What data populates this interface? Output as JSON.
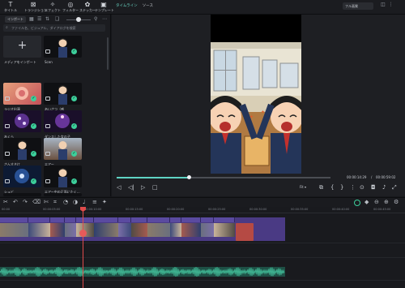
{
  "toolbar": {
    "tools": [
      {
        "icon": "text-T-icon",
        "label": "タイトル"
      },
      {
        "icon": "transition-icon",
        "label": "トランジション"
      },
      {
        "icon": "effects-icon",
        "label": "エフェクト"
      },
      {
        "icon": "filter-icon",
        "label": "フィルター"
      },
      {
        "icon": "sticker-icon",
        "label": "ステッカー"
      },
      {
        "icon": "template-icon",
        "label": "テンプレート"
      }
    ],
    "tabs": [
      "タイムライン",
      "ソース"
    ],
    "ratio": "フル画質"
  },
  "library": {
    "import_label": "インポート",
    "search_placeholder": "ファイル名、ビジュアル、ダイアログを検索",
    "items": [
      {
        "label": "メディアをインポート",
        "type": "import"
      },
      {
        "label": "Scen",
        "type": "video",
        "thumb": "person-dark"
      },
      {
        "label": "ラジオ出演",
        "type": "image",
        "thumb": "red-pink"
      },
      {
        "label": "あいさつ（感",
        "type": "image",
        "thumb": "person-dark"
      },
      {
        "label": "あくら",
        "type": "image",
        "thumb": "purple-sparkle"
      },
      {
        "label": "ダンスした女の子",
        "type": "image",
        "thumb": "purple-sparkle"
      },
      {
        "label": "さんすきけ",
        "type": "image",
        "thumb": "person-dark"
      },
      {
        "label": "エアー",
        "type": "image",
        "thumb": "person-dark"
      },
      {
        "label": "シュビ",
        "type": "image",
        "thumb": "blue-sparkle"
      },
      {
        "label": "エアー中の正面にたく…",
        "type": "image",
        "thumb": "person-dark"
      }
    ]
  },
  "preview": {
    "current_time": "00:00:14:29",
    "total_time": "00:00:59:02",
    "progress": 0.34,
    "zoom": "Fit"
  },
  "timeline": {
    "ruler_labels": [
      "00:00",
      "00:00:05:00",
      "00:00:10:00",
      "00:00:15:00",
      "00:00:20:00",
      "00:00:25:00",
      "00:00:30:00",
      "00:00:35:00",
      "00:00:40:00",
      "00:00:45:00"
    ]
  },
  "colors": {
    "accent": "#5fd3c4",
    "check": "#3ccf9b",
    "clip": "#4a3a84",
    "playhead": "#e04b4b"
  }
}
